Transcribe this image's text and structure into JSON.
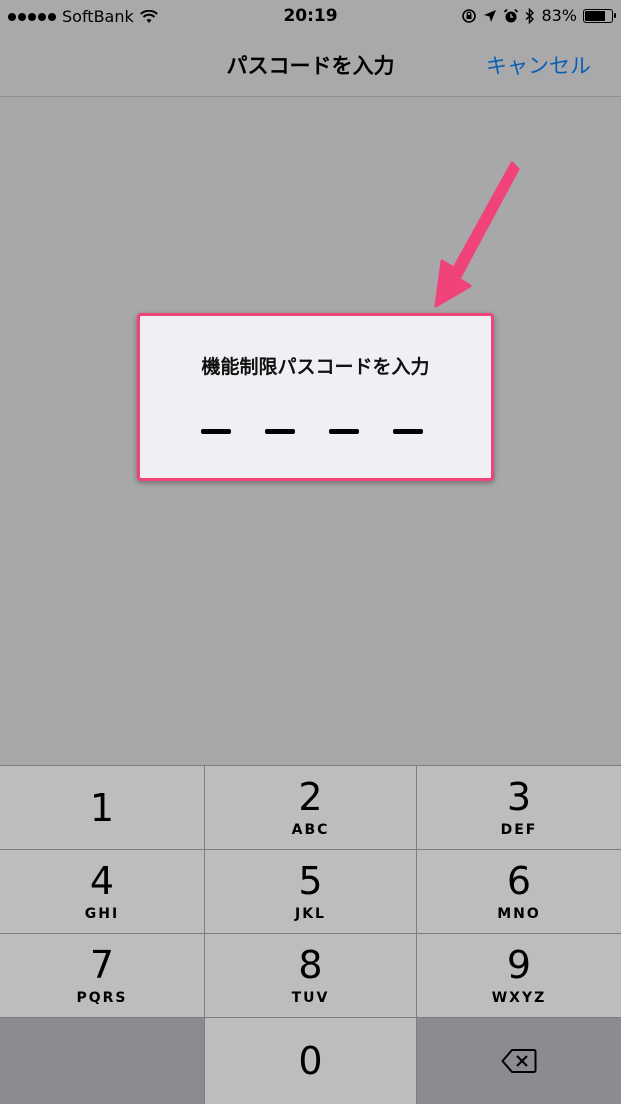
{
  "status_bar": {
    "carrier": "SoftBank",
    "time": "20:19",
    "battery_percent": "83%",
    "battery_level": 0.83
  },
  "nav": {
    "title": "パスコードを入力",
    "cancel_label": "キャンセル",
    "accent_color": "#0a5fb4"
  },
  "passcode": {
    "prompt": "機能制限パスコードを入力",
    "digits_entered": 0,
    "digits_total": 4,
    "highlight_color": "#f0437a"
  },
  "keypad": {
    "keys": [
      {
        "digit": "1",
        "letters": ""
      },
      {
        "digit": "2",
        "letters": "ABC"
      },
      {
        "digit": "3",
        "letters": "DEF"
      },
      {
        "digit": "4",
        "letters": "GHI"
      },
      {
        "digit": "5",
        "letters": "JKL"
      },
      {
        "digit": "6",
        "letters": "MNO"
      },
      {
        "digit": "7",
        "letters": "PQRS"
      },
      {
        "digit": "8",
        "letters": "TUV"
      },
      {
        "digit": "9",
        "letters": "WXYZ"
      },
      {
        "digit": "0",
        "letters": ""
      }
    ],
    "delete_icon": "delete-backspace-icon"
  }
}
